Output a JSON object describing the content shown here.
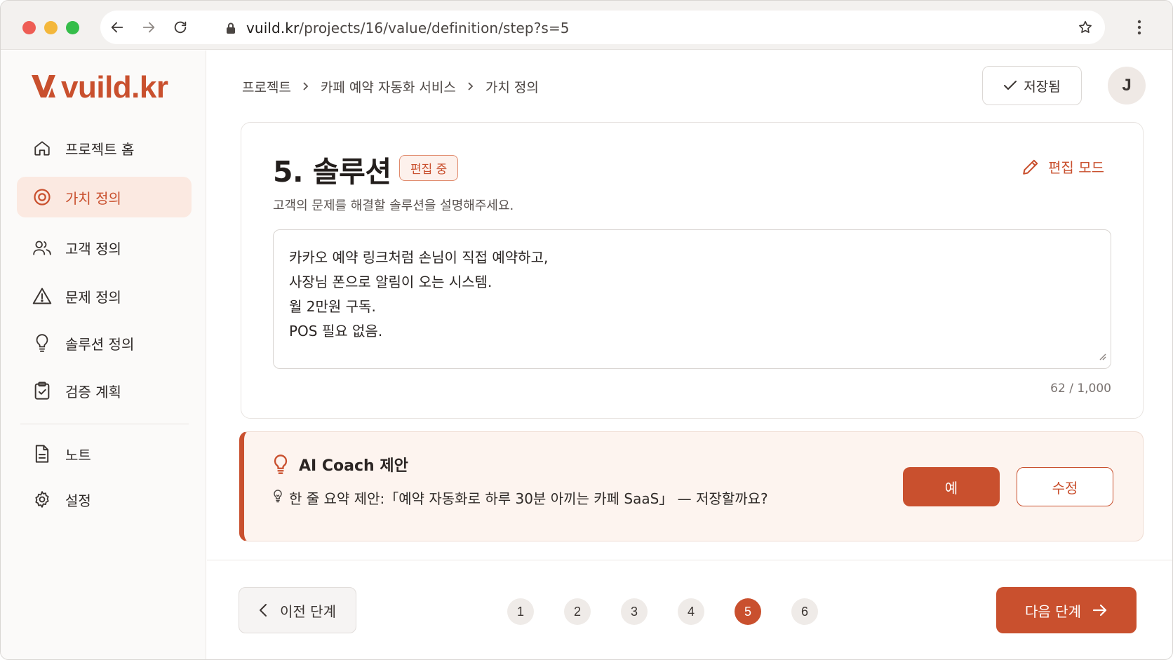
{
  "browser": {
    "url_host": "vuild.kr",
    "url_path": "/projects/16/value/definition/step?s=5"
  },
  "sidebar": {
    "logo_text": "vuild.kr",
    "items": [
      {
        "label": "프로젝트 홈",
        "icon": "home-icon"
      },
      {
        "label": "가치 정의",
        "icon": "target-icon",
        "active": true
      },
      {
        "label": "고객 정의",
        "icon": "users-icon"
      },
      {
        "label": "문제 정의",
        "icon": "warning-icon"
      },
      {
        "label": "솔루션 정의",
        "icon": "lightbulb-icon"
      },
      {
        "label": "검증 계획",
        "icon": "clipboard-check-icon"
      },
      {
        "label": "노트",
        "icon": "document-icon"
      },
      {
        "label": "설정",
        "icon": "gear-icon"
      }
    ]
  },
  "header": {
    "breadcrumb": [
      "프로젝트",
      "카페 예약 자동화 서비스",
      "가치 정의"
    ],
    "saved_label": "저장됨",
    "avatar_initial": "J"
  },
  "card": {
    "title": "5. 솔루션",
    "badge": "편집 중",
    "edit_mode_label": "편집 모드",
    "subtitle": "고객의 문제를 해결할 솔루션을 설명해주세요.",
    "textarea_value": "카카오 예약 링크처럼 손님이 직접 예약하고,\n사장님 폰으로 알림이 오는 시스템.\n월 2만원 구독.\nPOS 필요 없음.",
    "counter": "62 / 1,000"
  },
  "coach": {
    "title": "AI Coach 제안",
    "message": "한 줄 요약 제안:「예약 자동화로 하루 30분 아끼는 카페 SaaS」 — 저장할까요?",
    "yes_label": "예",
    "edit_label": "수정"
  },
  "footer": {
    "prev_label": "이전 단계",
    "next_label": "다음 단계",
    "steps": [
      "1",
      "2",
      "3",
      "4",
      "5",
      "6"
    ],
    "current_step": 5
  },
  "colors": {
    "accent": "#c9502e",
    "active_bg": "#fbe9e1",
    "coach_bg": "#fdf4ef"
  }
}
